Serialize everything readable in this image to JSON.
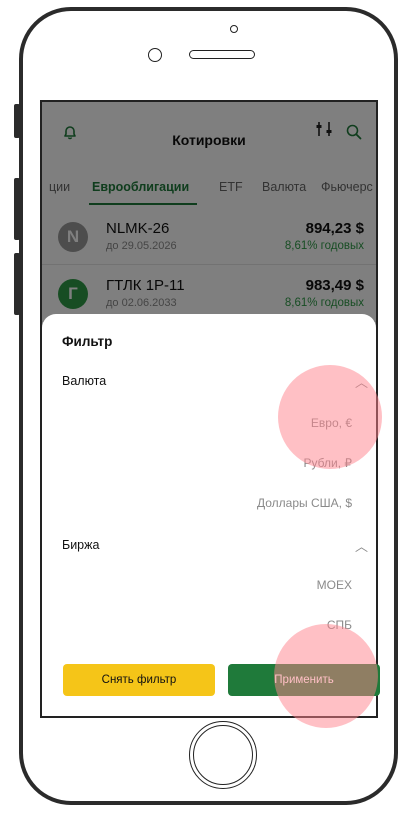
{
  "app_bar": {
    "title": "Котировки",
    "icons": [
      "bell-icon",
      "filter-sliders-icon",
      "search-icon"
    ]
  },
  "tabs": [
    {
      "label": "ции",
      "active": false
    },
    {
      "label": "Еврооблигации",
      "active": true
    },
    {
      "label": "ETF",
      "active": false
    },
    {
      "label": "Валюта",
      "active": false
    },
    {
      "label": "Фьючерс",
      "active": false
    }
  ],
  "quotes": [
    {
      "avatar": "N",
      "avatar_color": "#9a9a9a",
      "name": "NLMK-26",
      "sub": "до 29.05.2026",
      "price": "894,23 $",
      "yield": "8,61% годовых"
    },
    {
      "avatar": "Г",
      "avatar_color": "#2e9a47",
      "name": "ГТЛК 1P-11",
      "sub": "до 02.06.2033",
      "price": "983,49 $",
      "yield": "8,61% годовых"
    }
  ],
  "filter_sheet": {
    "title": "Фильтр",
    "currency_section": {
      "label": "Валюта",
      "options": [
        "Евро, €",
        "Рубли, ₽",
        "Доллары США, $"
      ]
    },
    "exchange_section": {
      "label": "Биржа",
      "options": [
        "MOEX",
        "СПБ"
      ]
    },
    "reset_button": "Снять фильтр",
    "apply_button": "Применить"
  },
  "colors": {
    "accent_green": "#1f7a3a",
    "yield_green": "#2e9a47",
    "reset_yellow": "#f5c518"
  }
}
